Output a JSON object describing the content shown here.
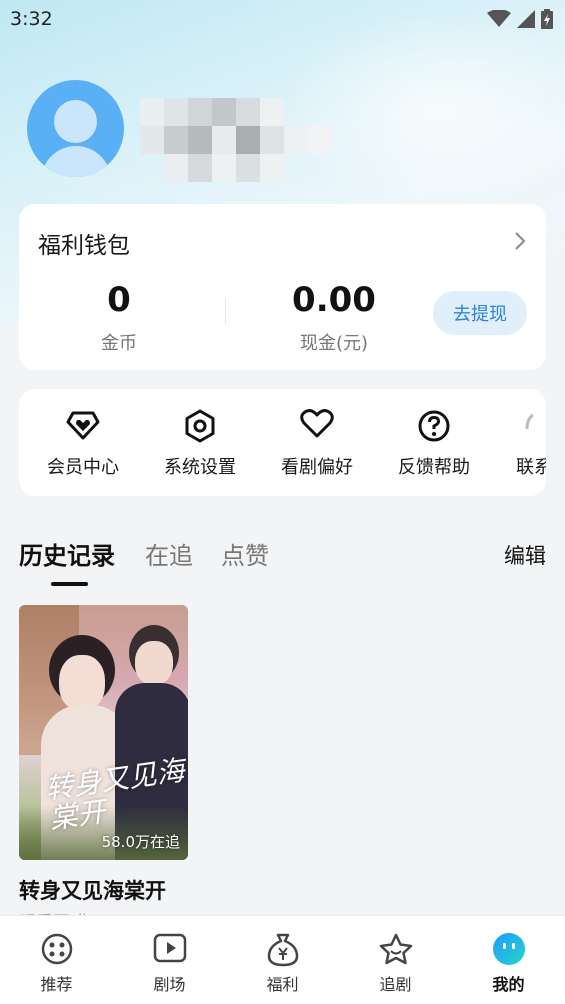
{
  "status_bar": {
    "time": "3:32"
  },
  "wallet": {
    "title": "福利钱包",
    "coins": {
      "value": "0",
      "label": "金币"
    },
    "cash": {
      "value": "0.00",
      "label": "现金(元)"
    },
    "withdraw_label": "去提现"
  },
  "tools": [
    {
      "label": "会员中心",
      "icon": "vip-heart-icon"
    },
    {
      "label": "系统设置",
      "icon": "settings-hexagon-icon"
    },
    {
      "label": "看剧偏好",
      "icon": "heart-icon"
    },
    {
      "label": "反馈帮助",
      "icon": "help-icon"
    },
    {
      "label": "联系",
      "icon": "contact-icon"
    }
  ],
  "tabs": [
    {
      "label": "历史记录",
      "active": true
    },
    {
      "label": "在追",
      "active": false
    },
    {
      "label": "点赞",
      "active": false
    }
  ],
  "edit_label": "编辑",
  "history": [
    {
      "poster_title_art": "转身又见海棠开",
      "follow_count": "58.0万在追",
      "title": "转身又见海棠开",
      "subtitle": "观看至 集"
    }
  ],
  "bottom_nav": [
    {
      "label": "推荐",
      "icon": "recommend-icon",
      "active": false
    },
    {
      "label": "剧场",
      "icon": "theater-play-icon",
      "active": false
    },
    {
      "label": "福利",
      "icon": "welfare-bag-icon",
      "active": false
    },
    {
      "label": "追剧",
      "icon": "follow-star-icon",
      "active": false
    },
    {
      "label": "我的",
      "icon": "profile-face-icon",
      "active": true
    }
  ],
  "colors": {
    "accent_blue": "#2c84d8",
    "withdraw_bg": "#e1effb",
    "avatar_blue": "#5ab0f5"
  }
}
